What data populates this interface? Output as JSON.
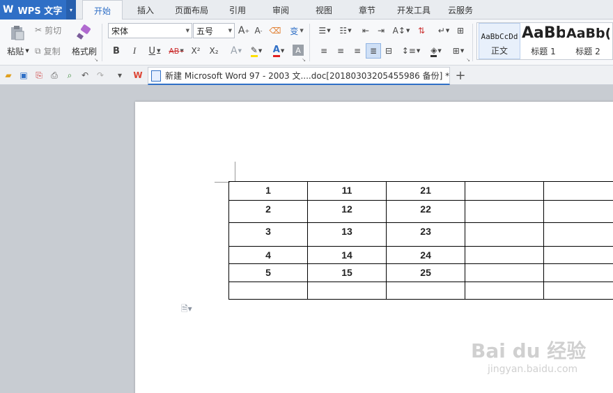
{
  "app": {
    "logo_w": "W",
    "logo_text": "WPS 文字",
    "drop": "▾"
  },
  "menu_tabs": [
    "开始",
    "插入",
    "页面布局",
    "引用",
    "审阅",
    "视图",
    "章节",
    "开发工具",
    "云服务"
  ],
  "ribbon": {
    "paste_label": "粘贴",
    "cut_label": "剪切",
    "copy_label": "复制",
    "format_painter_label": "格式刷",
    "font_name": "宋体",
    "font_size": "五号",
    "bold": "B",
    "italic": "I",
    "underline": "U",
    "strike": "AB",
    "superscript": "X²",
    "subscript": "X₂",
    "font_color": "A",
    "styles": [
      {
        "preview": "AaBbCcDd",
        "name": "正文"
      },
      {
        "preview": "AaBb",
        "name": "标题 1"
      },
      {
        "preview": "AaBb(",
        "name": "标题 2"
      }
    ]
  },
  "doc_tab": {
    "title": "新建 Microsoft Word 97 - 2003 文....doc[20180303205455986 备份] *",
    "close": "✕"
  },
  "new_tab": "+",
  "table": {
    "rows": [
      [
        "1",
        "11",
        "21",
        "",
        ""
      ],
      [
        "2",
        "12",
        "22",
        "",
        ""
      ],
      [
        "3",
        "13",
        "23",
        "",
        ""
      ],
      [
        "4",
        "14",
        "24",
        "",
        ""
      ],
      [
        "5",
        "15",
        "25",
        "",
        ""
      ],
      [
        "",
        "",
        "",
        "",
        ""
      ]
    ]
  },
  "watermark": {
    "brand": "Bai du 经验",
    "url": "jingyan.baidu.com"
  },
  "colors": {
    "accent": "#2f6fc6",
    "workspace": "#c8ccd2"
  }
}
